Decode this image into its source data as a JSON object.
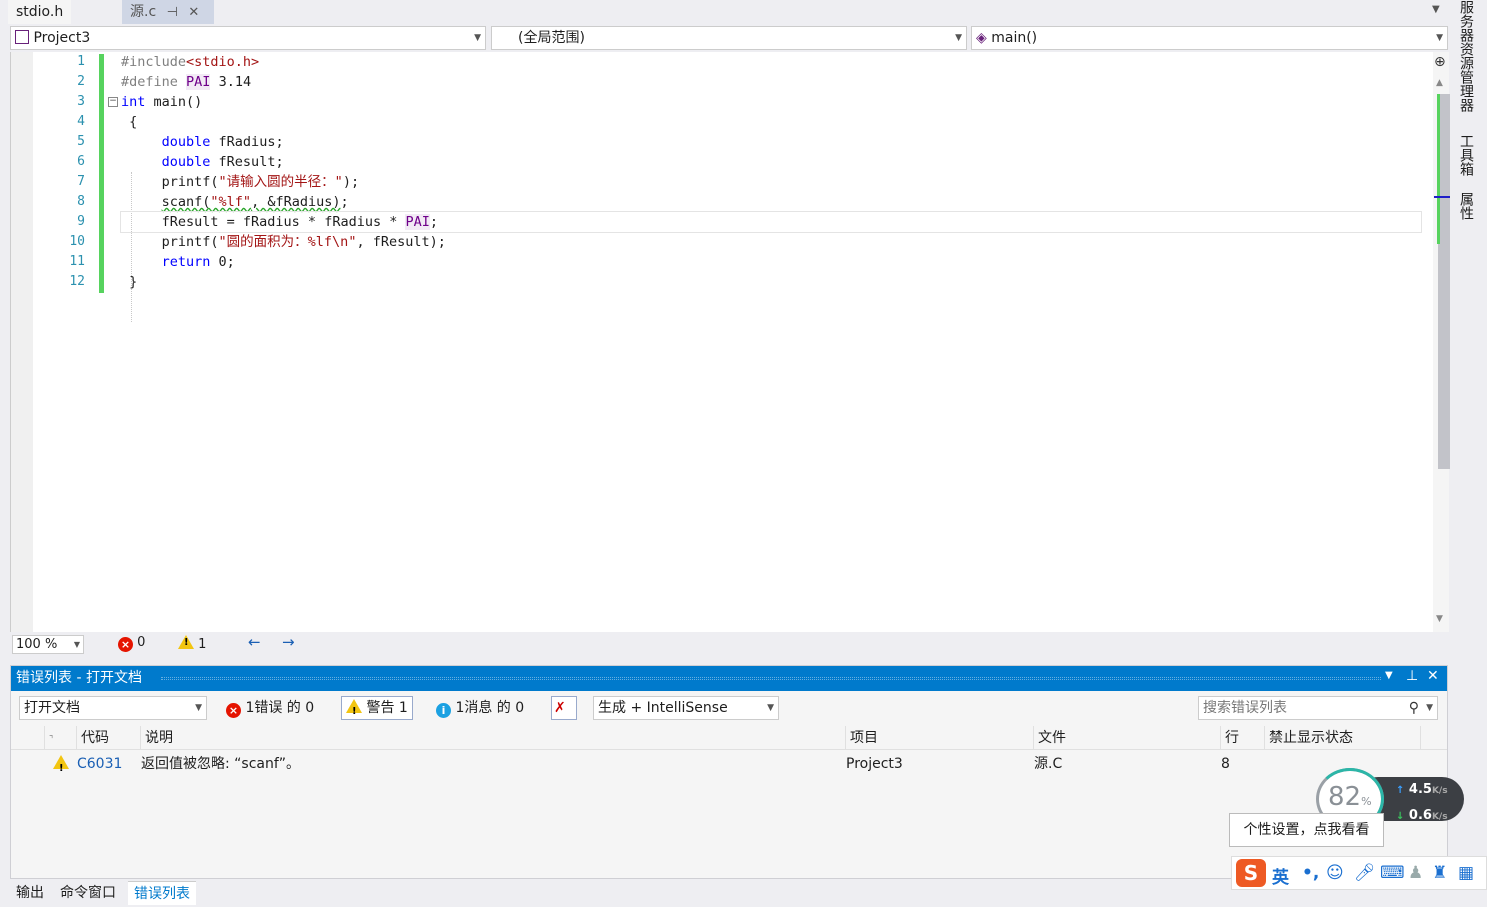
{
  "tabs": [
    {
      "label": "stdio.h"
    },
    {
      "label": "源.c",
      "pin": "⊣",
      "close": "✕"
    }
  ],
  "navbar": {
    "project": "Project3",
    "scope": "(全局范围)",
    "function": "main()"
  },
  "editor": {
    "line_numbers": [
      "1",
      "2",
      "3",
      "4",
      "5",
      "6",
      "7",
      "8",
      "9",
      "10",
      "11",
      "12"
    ]
  },
  "status": {
    "zoom": "100 %",
    "error_count": "0",
    "warning_count": "1"
  },
  "side_tabs": [
    "服务器资源管理器",
    "工具箱",
    "属性"
  ],
  "error_list": {
    "title": "错误列表 - 打开文档",
    "scope_filter": "打开文档",
    "errors_btn": "1错误 的 0",
    "warnings_btn": "警告 1",
    "messages_btn": "1消息 的 0",
    "source_filter": "生成 + IntelliSense",
    "search_placeholder": "搜索错误列表",
    "columns": [
      "代码",
      "说明",
      "项目",
      "文件",
      "行",
      "禁止显示状态"
    ],
    "rows": [
      {
        "code": "C6031",
        "description": "返回值被忽略: “scanf”。",
        "project": "Project3",
        "file": "源.C",
        "line": "8",
        "suppression": ""
      }
    ]
  },
  "bottom_tabs": [
    "输出",
    "命令窗口",
    "错误列表"
  ],
  "speed_widget": {
    "percent": "82",
    "percent_unit": "%",
    "up": "4.5",
    "down": "0.6",
    "unit": "K/s"
  },
  "tooltip": "个性设置，点我看看",
  "ime": {
    "lang": "英",
    "punct": "•,"
  }
}
